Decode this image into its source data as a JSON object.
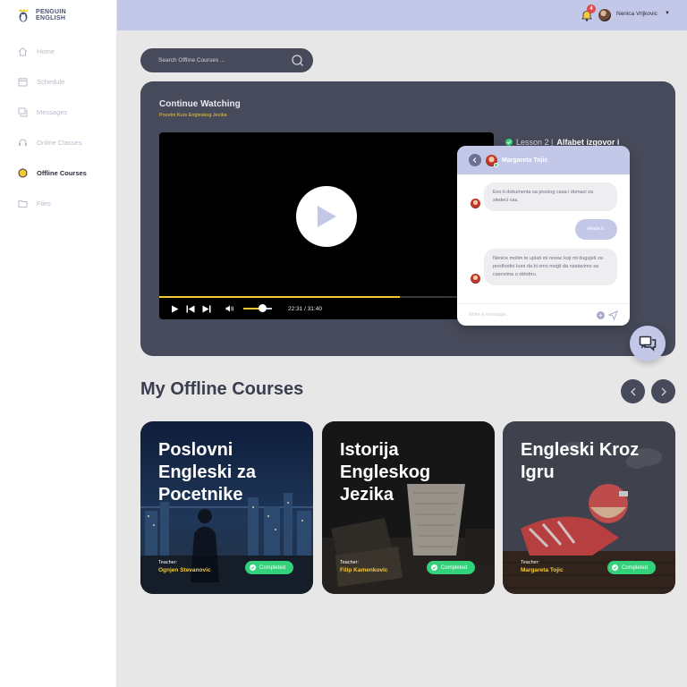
{
  "brand": {
    "line1": "PENGUIN",
    "line2": "ENGLISH"
  },
  "sidebar": {
    "items": [
      {
        "label": "Home",
        "icon": "home-icon"
      },
      {
        "label": "Schedule",
        "icon": "calendar-icon"
      },
      {
        "label": "Messages",
        "icon": "messages-icon"
      },
      {
        "label": "Online Classes",
        "icon": "headset-icon"
      },
      {
        "label": "Offline Courses",
        "icon": "offline-icon",
        "active": true
      },
      {
        "label": "Files",
        "icon": "folder-icon"
      }
    ]
  },
  "header": {
    "notifications": "4",
    "user_name": "Nenica Vrljkovic"
  },
  "search": {
    "placeholder": "Search Offline Courses ..."
  },
  "continue": {
    "title": "Continue Watching",
    "subtitle": "Pocetni Kurs Engleskog Jezika",
    "lesson_prefix": "Lesson 2 |",
    "lesson_title": "Alfabet izgovor i",
    "time": "22:31 / 31:40",
    "progress": 0.72,
    "volume": 0.65
  },
  "chat": {
    "name": "Margareta Tojic",
    "messages": [
      {
        "text": "Evo ti dokumenta sa proslog casa i domaci za sledeci cas.",
        "from": "them"
      },
      {
        "text": "Hvala ti.",
        "from": "me"
      },
      {
        "text": "Nenice molim te uplati mi novac koji mi duguješ za predhodni kurs da bi smo mogli da nastavimo sa casovima u oktobru.",
        "from": "them"
      }
    ],
    "placeholder": "Write a message..."
  },
  "courses": {
    "title": "My Offline Courses",
    "teacher_label": "Teacher:",
    "items": [
      {
        "title": "Poslovni Engleski za Pocetnike",
        "teacher": "Ognjen Stevanovic",
        "status": "Completed"
      },
      {
        "title": "Istorija Engleskog Jezika",
        "teacher": "Filip Kamenkovic",
        "status": "Completed"
      },
      {
        "title": "Engleski Kroz Igru",
        "teacher": "Margareta Tojic",
        "status": "Completed"
      }
    ]
  },
  "colors": {
    "accent": "#f3c93a",
    "panel": "#474a5a",
    "header": "#c3c8e8",
    "success": "#33d17a"
  }
}
